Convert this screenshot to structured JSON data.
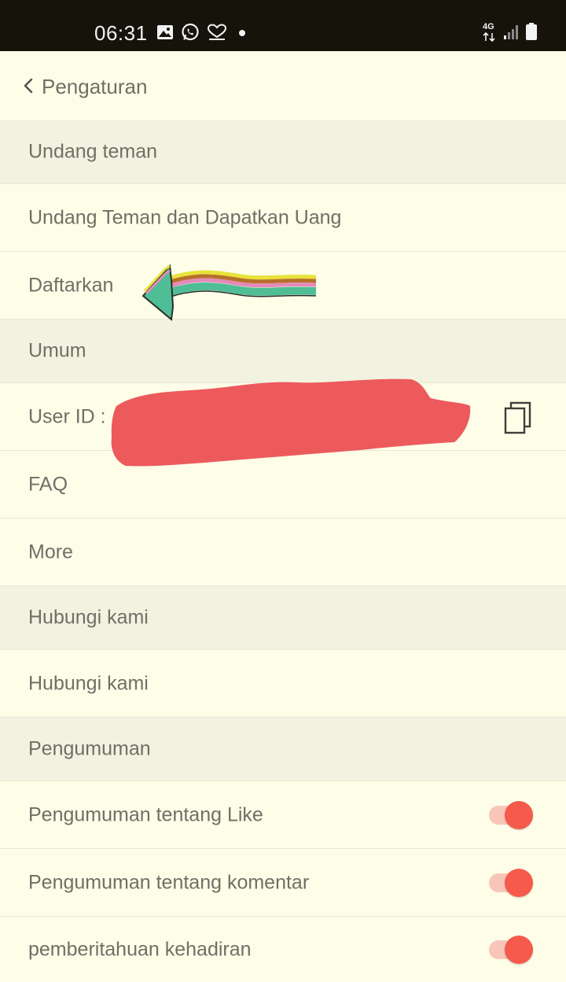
{
  "status_bar": {
    "time": "06:31",
    "left_icons": [
      "gallery-icon",
      "whatsapp-icon",
      "heart-chat-icon",
      "notification-dot-icon"
    ],
    "network": "4G",
    "right_icons": [
      "signal-icon",
      "battery-icon"
    ]
  },
  "header": {
    "title": "Pengaturan",
    "back_icon": "chevron-left-icon"
  },
  "sections": {
    "invite": {
      "header": "Undang teman",
      "items": {
        "invite_earn": "Undang Teman dan Dapatkan Uang",
        "register": "Daftarkan"
      }
    },
    "general": {
      "header": "Umum",
      "items": {
        "user_id": "User ID :",
        "faq": "FAQ",
        "more": "More"
      }
    },
    "contact": {
      "header": "Hubungi kami",
      "items": {
        "contact_us": "Hubungi kami"
      }
    },
    "announcements": {
      "header": "Pengumuman",
      "items": [
        {
          "label": "Pengumuman tentang Like",
          "enabled": true
        },
        {
          "label": "Pengumuman tentang komentar",
          "enabled": true
        },
        {
          "label": "pemberitahuan kehadiran",
          "enabled": true
        }
      ]
    }
  },
  "colors": {
    "background": "#FDFDE8",
    "section_background": "#F2F2E1",
    "status_bar": "#16130A",
    "text": "#6F6F66",
    "toggle_knob": "#F55A4B",
    "toggle_track": "#F8C6B8",
    "redaction": "#EC5A5C"
  },
  "annotations": {
    "arrow_icon": "rainbow-arrow-icon",
    "redaction": "red-redaction-scribble"
  }
}
